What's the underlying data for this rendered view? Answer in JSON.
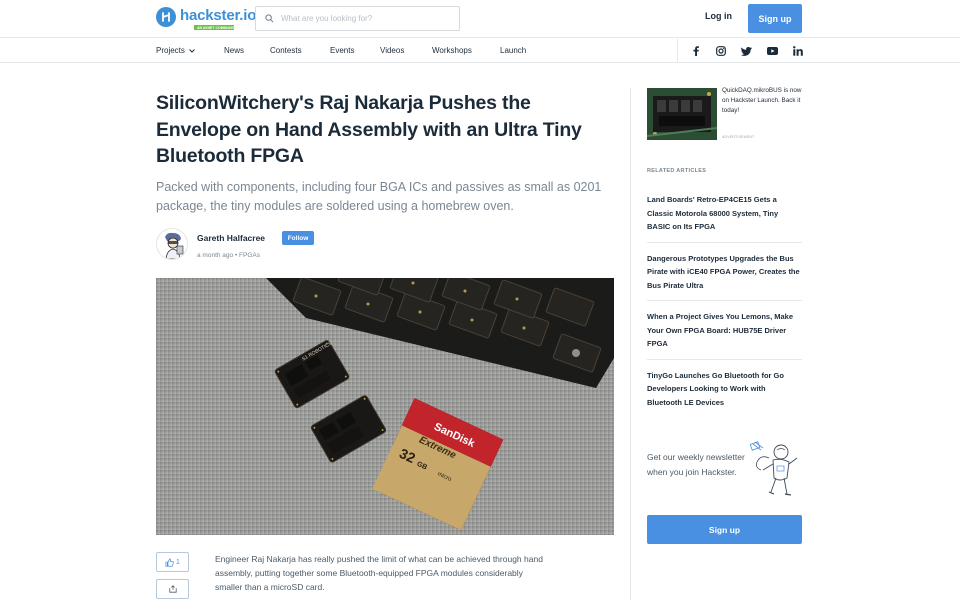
{
  "brand": {
    "name": "hackster.io",
    "badge": "AN AVNET COMMUNITY",
    "color": "#3d8fd6"
  },
  "header": {
    "search_placeholder": "What are you looking for?",
    "login_label": "Log in",
    "signup_label": "Sign up"
  },
  "nav": {
    "items": [
      "Projects",
      "News",
      "Contests",
      "Events",
      "Videos",
      "Workshops",
      "Launch"
    ],
    "social_icons": [
      "facebook-icon",
      "instagram-icon",
      "twitter-icon",
      "youtube-icon",
      "linkedin-icon"
    ]
  },
  "article": {
    "title": "SiliconWitchery's Raj Nakarja Pushes the Envelope on Hand Assembly with an Ultra Tiny Bluetooth FPGA",
    "subtitle": "Packed with components, including four BGA ICs and passives as small as 0201 package, the tiny modules are soldered using a homebrew oven.",
    "author": "Gareth Halfacree",
    "follow_label": "Follow",
    "time": "a month ago",
    "separator": "•",
    "tag": "FPGAs",
    "likes": "1",
    "body": "Engineer Raj Nakarja has really pushed the limit of what can be achieved through hand assembly, putting together some Bluetooth-equipped FPGA modules considerably smaller than a microSD card."
  },
  "hero_image": {
    "board_label": "S1 ROBOTICS",
    "card_brand": "SanDisk",
    "card_line": "Extreme",
    "card_capacity": "32",
    "card_unit": "GB",
    "card_type": "micro"
  },
  "sidebar": {
    "ad_text": "QuickDAQ.mikroBUS is now on Hackster Launch. Back it today!",
    "ad_label": "ADVERTISEMENT",
    "related_heading": "RELATED ARTICLES",
    "related": [
      "Land Boards' Retro-EP4CE15 Gets a Classic Motorola 68000 System, Tiny BASIC on Its FPGA",
      "Dangerous Prototypes Upgrades the Bus Pirate with iCE40 FPGA Power, Creates the Bus Pirate Ultra",
      "When a Project Gives You Lemons, Make Your Own FPGA Board: HUB75E Driver FPGA",
      "TinyGo Launches Go Bluetooth for Go Developers Looking to Work with Bluetooth LE Devices"
    ],
    "newsletter_text": "Get our weekly newsletter when you join Hackster.",
    "signup_label": "Sign up"
  },
  "colors": {
    "accent": "#4a90e2",
    "text": "#1c2b39",
    "muted": "#7a8793"
  }
}
